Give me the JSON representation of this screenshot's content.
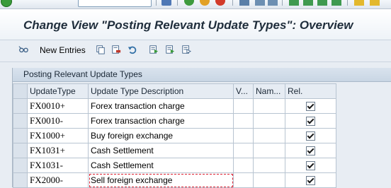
{
  "window": {
    "title": "Change View \"Posting Relevant Update Types\": Overview"
  },
  "toolbar": {
    "new_entries_label": "New Entries",
    "icons": [
      "glasses-icon",
      "copy-icon",
      "delete-icon",
      "undo-icon",
      "select-all-icon",
      "select-block-icon",
      "deselect-all-icon"
    ]
  },
  "panel": {
    "title": "Posting Relevant Update Types",
    "columns": [
      "UpdateType",
      "Update Type Description",
      "V...",
      "Nam...",
      "Rel."
    ],
    "rows": [
      {
        "code": "FX0010+",
        "description": "Forex transaction charge",
        "v": "",
        "name": "",
        "relevant": true
      },
      {
        "code": "FX0010-",
        "description": "Forex transaction charge",
        "v": "",
        "name": "",
        "relevant": true
      },
      {
        "code": "FX1000+",
        "description": "Buy foreign exchange",
        "v": "",
        "name": "",
        "relevant": true
      },
      {
        "code": "FX1031+",
        "description": "Cash Settlement",
        "v": "",
        "name": "",
        "relevant": true
      },
      {
        "code": "FX1031-",
        "description": "Cash Settlement",
        "v": "",
        "name": "",
        "relevant": true
      },
      {
        "code": "FX2000-",
        "description": "Sell foreign exchange",
        "v": "",
        "name": "",
        "relevant": true
      }
    ]
  },
  "colors": {
    "background": "#e8edf3",
    "ok_green": "#3a9b3a"
  }
}
